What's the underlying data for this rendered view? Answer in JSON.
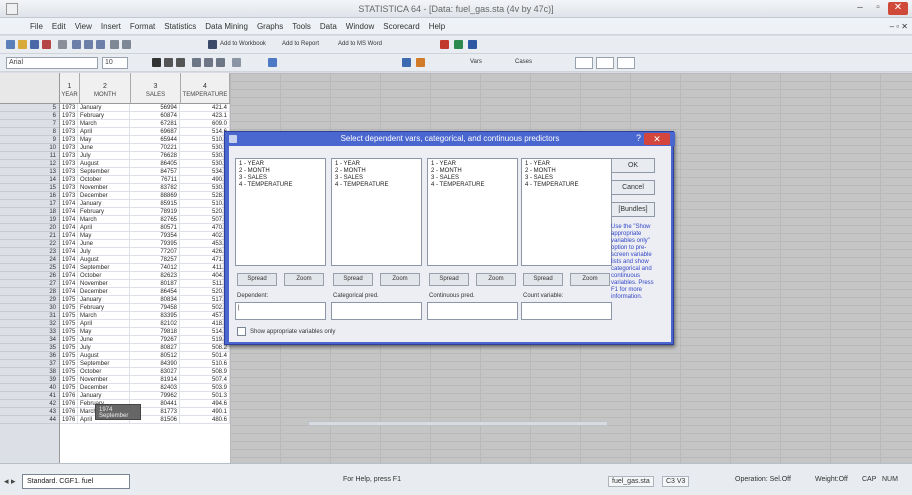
{
  "window": {
    "title": "STATISTICA 64 - [Data: fuel_gas.sta (4v by 47c)]",
    "buttons": [
      "–",
      "▫",
      "✕"
    ]
  },
  "menu": {
    "items": [
      "File",
      "Edit",
      "View",
      "Insert",
      "Format",
      "Statistics",
      "Data Mining",
      "Graphs",
      "Tools",
      "Data",
      "Window",
      "Scorecard",
      "Help"
    ],
    "mdi_buttons": "– ▫ ✕"
  },
  "toolbar1": {
    "icon_names": [
      "new-icon",
      "open-icon",
      "save-icon",
      "print-icon",
      "preview-icon",
      "cut-icon",
      "copy-icon",
      "paste-icon",
      "undo-icon",
      "find-icon"
    ],
    "add_workbook": "Add to Workbook",
    "add_report": "Add to Report",
    "add_ms_word": "Add to MS Word"
  },
  "toolbar2": {
    "font": "Arial",
    "size": "10",
    "vars_label": "Vars",
    "cases_label": "Cases",
    "icon_names": [
      "bold-icon",
      "italic-icon",
      "underline-icon",
      "align-left-icon",
      "align-center-icon",
      "align-right-icon",
      "grid-icon",
      "chart-icon"
    ]
  },
  "spreadsheet": {
    "columns": [
      {
        "num": "1",
        "name": "YEAR"
      },
      {
        "num": "2",
        "name": "MONTH"
      },
      {
        "num": "3",
        "name": "SALES"
      },
      {
        "num": "4",
        "name": "TEMPERATURE"
      }
    ],
    "row_numbers": [
      "5",
      "6",
      "7",
      "8",
      "9",
      "10",
      "11",
      "12",
      "13",
      "14",
      "15",
      "16",
      "17",
      "18",
      "19",
      "20",
      "21",
      "22",
      "23",
      "24",
      "25",
      "26",
      "27",
      "28",
      "29",
      "30",
      "31",
      "32",
      "33",
      "34",
      "35",
      "36",
      "37",
      "38",
      "39",
      "40",
      "41",
      "42",
      "43",
      "44"
    ],
    "rows": [
      [
        "1973",
        "January",
        "56994",
        "421.4"
      ],
      [
        "1973",
        "February",
        "60874",
        "423.1"
      ],
      [
        "1973",
        "March",
        "67281",
        "609.0"
      ],
      [
        "1973",
        "April",
        "69687",
        "514.6"
      ],
      [
        "1973",
        "May",
        "65944",
        "510.8"
      ],
      [
        "1973",
        "June",
        "70221",
        "530.9"
      ],
      [
        "1973",
        "July",
        "76628",
        "530.6"
      ],
      [
        "1973",
        "August",
        "86405",
        "530.2"
      ],
      [
        "1973",
        "September",
        "84757",
        "534.7"
      ],
      [
        "1973",
        "October",
        "76711",
        "490.6"
      ],
      [
        "1973",
        "November",
        "83782",
        "530.6"
      ],
      [
        "1973",
        "December",
        "88869",
        "528.6"
      ],
      [
        "1974",
        "January",
        "85915",
        "510.2"
      ],
      [
        "1974",
        "February",
        "78919",
        "520.9"
      ],
      [
        "1974",
        "March",
        "82765",
        "507.0"
      ],
      [
        "1974",
        "April",
        "80571",
        "470.6"
      ],
      [
        "1974",
        "May",
        "79354",
        "402.9"
      ],
      [
        "1974",
        "June",
        "79395",
        "453.3"
      ],
      [
        "1974",
        "July",
        "77207",
        "426.8"
      ],
      [
        "1974",
        "August",
        "78257",
        "471.2"
      ],
      [
        "1974",
        "September",
        "74012",
        "411.3"
      ],
      [
        "1974",
        "October",
        "82623",
        "404.5"
      ],
      [
        "1974",
        "November",
        "80187",
        "511.6"
      ],
      [
        "1974",
        "December",
        "86454",
        "520.9"
      ],
      [
        "1975",
        "January",
        "80834",
        "517.6"
      ],
      [
        "1975",
        "February",
        "79458",
        "502.8"
      ],
      [
        "1975",
        "March",
        "83395",
        "457.6"
      ],
      [
        "1975",
        "April",
        "82102",
        "418.9"
      ],
      [
        "1975",
        "May",
        "79818",
        "514.1"
      ],
      [
        "1975",
        "June",
        "79267",
        "519.4"
      ],
      [
        "1975",
        "July",
        "80827",
        "508.2"
      ],
      [
        "1975",
        "August",
        "80512",
        "501.4"
      ],
      [
        "1975",
        "September",
        "84390",
        "510.6"
      ],
      [
        "1975",
        "October",
        "83027",
        "508.9"
      ],
      [
        "1975",
        "November",
        "81914",
        "507.4"
      ],
      [
        "1975",
        "December",
        "82403",
        "503.9"
      ],
      [
        "1976",
        "January",
        "79962",
        "501.3"
      ],
      [
        "1976",
        "February",
        "80441",
        "494.6"
      ],
      [
        "1976",
        "March",
        "81773",
        "490.1"
      ],
      [
        "1976",
        "April",
        "81506",
        "480.6"
      ]
    ],
    "tooltip_line1": "1974",
    "tooltip_line2": "September"
  },
  "dialog": {
    "title": "Select dependent vars, categorical, and continuous predictors",
    "help_glyph": "?",
    "close_glyph": "✕",
    "variables": [
      "1 - YEAR",
      "2 - MONTH",
      "3 - SALES",
      "4 - TEMPERATURE"
    ],
    "list_buttons": [
      "Spread",
      "Zoom"
    ],
    "labels": [
      "Dependent:",
      "Categorical pred.",
      "Continuous pred.",
      "Count variable:"
    ],
    "dependent_value": "|",
    "show_appropriate": "Show appropriate variables only",
    "ok": "OK",
    "cancel": "Cancel",
    "bundles": "[Bundles]",
    "hint": "Use the \"Show appropriate variables only\" option to pre-screen variable lists and show categorical and continuous variables. Press F1 for more information."
  },
  "statusbar": {
    "nav_arrows": "◂ ▸",
    "workbook_tab": "Standard. CGF1. fuel",
    "help_text": "For Help, press F1",
    "file": "fuel_gas.sta",
    "cell": "C3 V3",
    "selection": "Operation: Sel.Off",
    "weight": "Weight:Off",
    "cap": "CAP",
    "num": "NUM",
    "colors": {
      "accent": "#4a66cf",
      "close": "#d4453c"
    }
  }
}
